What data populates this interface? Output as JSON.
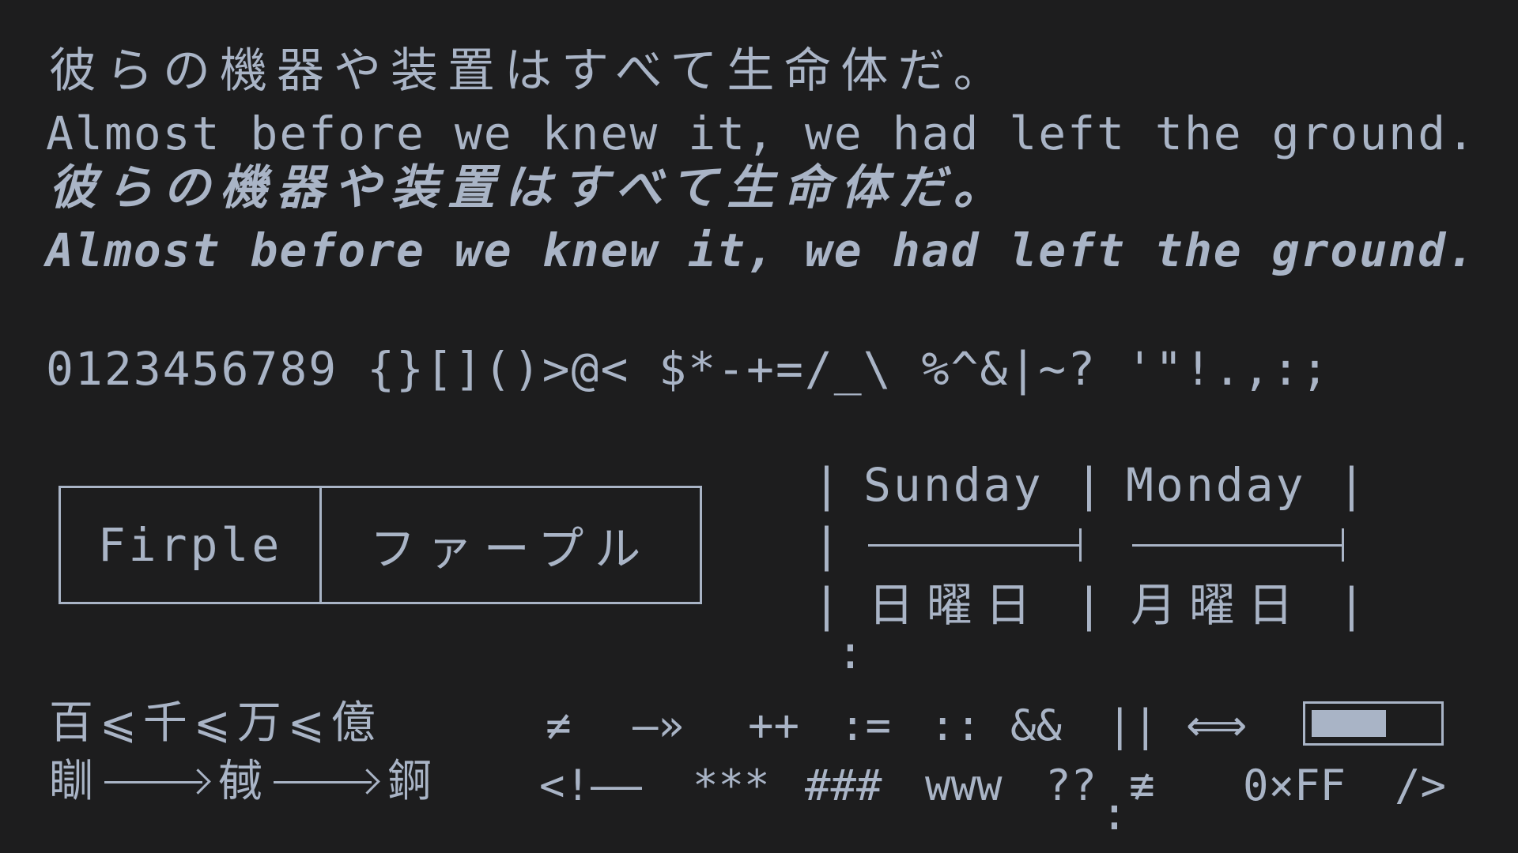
{
  "samples": {
    "jp_regular": "彼らの機器や装置はすべて生命体だ。",
    "en_regular": "Almost before we knew it, we had left the ground.",
    "jp_bold": "彼らの機器や装置はすべて生命体だ。",
    "en_bold": "Almost before we knew it, we had left the ground."
  },
  "glyphs": "0123456789 {}[]()>@< $*-+=/_\\ %^&|~? '\"!.,:;",
  "name_box": {
    "latin": "Firple",
    "katakana": "ファープル"
  },
  "table": {
    "headers": [
      "Sunday",
      "Monday"
    ],
    "cells": [
      "日曜日",
      "月曜日"
    ],
    "pipe": "|",
    "colon": ":"
  },
  "kanji_order": {
    "items": [
      "百",
      "千",
      "万",
      "億"
    ],
    "separator": "⩽"
  },
  "kanji_arrow": {
    "items": [
      "瞓",
      "戫",
      "錒"
    ]
  },
  "ligatures_row1": {
    "neq": "≠",
    "arrow": "—»",
    "plusplus": "++",
    "assign": ":=",
    "dcolon": "::",
    "and": "&&",
    "or": "||",
    "iff": "⟺"
  },
  "ligatures_row2": {
    "comment": "<!——",
    "stars": "***",
    "hashes": "###",
    "www": "www",
    "qq": "??",
    "neqv": "≢",
    "hex": "0×FF",
    "selfclose": "/>"
  },
  "progress": {
    "fraction": 0.6
  },
  "colors": {
    "background": "#1d1d1e",
    "foreground": "#a9b4c6"
  }
}
